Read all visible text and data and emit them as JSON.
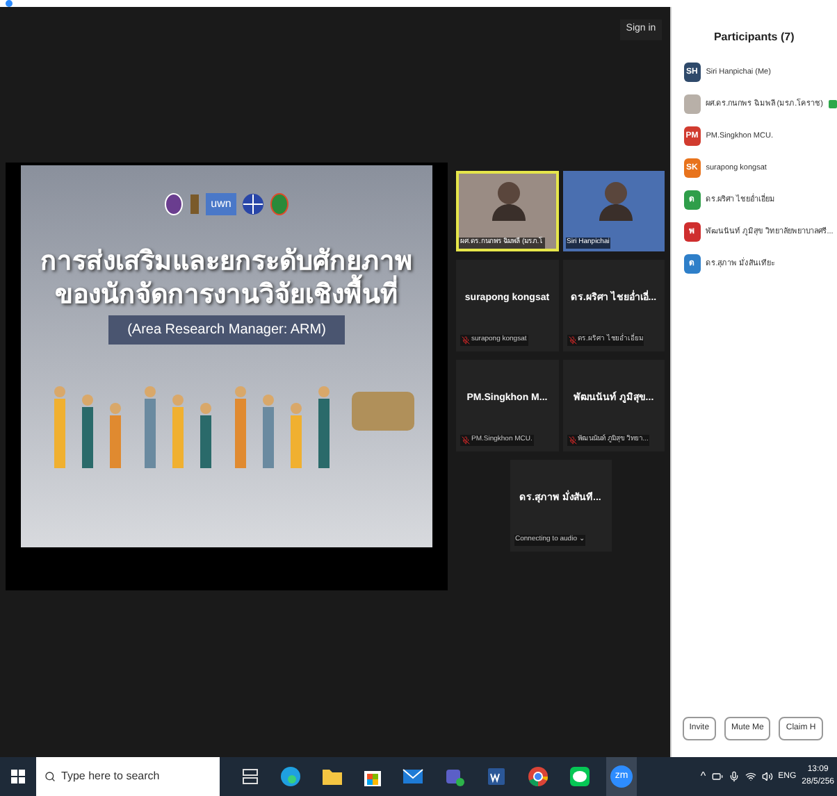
{
  "top_bar": {
    "sign_in": "Sign in"
  },
  "shared_slide": {
    "logo_text": "uwn",
    "title_lines": [
      "การส่งเสริมและยกระดับศักยภาพ",
      "ของนักจัดการงานวิจัยเชิงพื้นที่"
    ],
    "subtitle": "(Area Research Manager: ARM)"
  },
  "gallery": [
    {
      "kind": "video",
      "label": "ผศ.ดร.กนกพร ฉิมพลี (มรภ.โ",
      "active": true
    },
    {
      "kind": "video",
      "label": "Siri Hanpichai",
      "active": false
    },
    {
      "kind": "name",
      "name": "surapong kongsat",
      "label": "surapong kongsat",
      "muted": true
    },
    {
      "kind": "name",
      "name": "ดร.ผริศา ไชยอ่ำเอี่...",
      "label": "ดร.ผริศา ไชยอ่ำเอี่ยม",
      "muted": true
    },
    {
      "kind": "name",
      "name": "PM.Singkhon  M...",
      "label": "PM.Singkhon MCU.",
      "muted": true
    },
    {
      "kind": "name",
      "name": "พัฒนนันท์  ภูมิสุข...",
      "label": "พัฒนนันท์ ภูมิสุข  วิทยา...",
      "muted": true
    },
    {
      "kind": "name",
      "name": "ดร.สุภาพ มั่งสันที...",
      "label": "Connecting to audio ⌄",
      "muted": false
    }
  ],
  "participants": {
    "title": "Participants (7)",
    "items": [
      {
        "initials": "SH",
        "color": "#2f4a6b",
        "name": "Siri Hanpichai (Me)",
        "badge": false
      },
      {
        "color": "#b8b0a8",
        "name": "ผศ.ดร.กนกพร ฉิมพลี (มรภ.โคราช)",
        "badge": true
      },
      {
        "initials": "PM",
        "color": "#d13b2f",
        "name": "PM.Singkhon MCU.",
        "badge": false
      },
      {
        "initials": "SK",
        "color": "#e8731c",
        "name": "surapong kongsat",
        "badge": false
      },
      {
        "initials": "ด",
        "color": "#2f9e4a",
        "name": "ดร.ผริศา ไชยอ่ำเอี่ยม",
        "badge": false
      },
      {
        "initials": "พ",
        "color": "#cf2e2e",
        "name": "พัฒนนันท์ ภูมิสุข  วิทยาลัยพยาบาลศรี...",
        "badge": false
      },
      {
        "initials": "ด",
        "color": "#2e7fc9",
        "name": "ดร.สุภาพ มั่งสันเทียะ",
        "badge": false
      }
    ],
    "buttons": [
      "Invite",
      "Mute Me",
      "Claim H"
    ]
  },
  "taskbar": {
    "search_placeholder": "Type here to search",
    "apps": [
      {
        "kind": "taskview",
        "active": false
      },
      {
        "kind": "edge",
        "active": false
      },
      {
        "kind": "folder",
        "active": false
      },
      {
        "kind": "store",
        "active": false
      },
      {
        "kind": "mail",
        "active": false
      },
      {
        "kind": "teams",
        "active": false
      },
      {
        "kind": "word",
        "active": false
      },
      {
        "kind": "chrome",
        "active": false
      },
      {
        "kind": "line",
        "active": false
      },
      {
        "kind": "zoom",
        "label": "zm",
        "active": true
      }
    ],
    "caret": "^",
    "language": "ENG",
    "time": "13:09",
    "date": "28/5/256"
  }
}
